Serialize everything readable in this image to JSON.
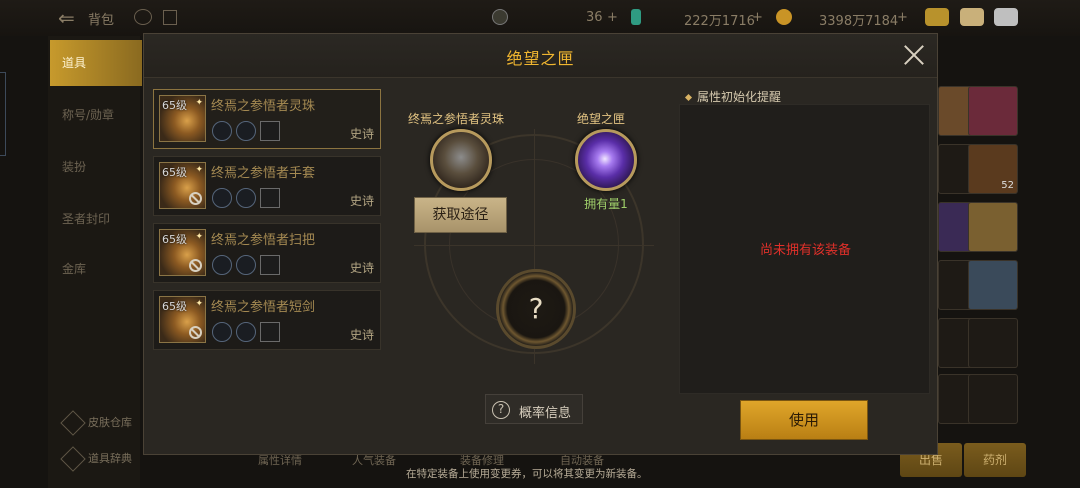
{
  "background": {
    "title": "背包",
    "currencies": [
      {
        "icon": "crescent-icon",
        "value": "36"
      },
      {
        "icon": "green-gem-icon",
        "value": "222万1716"
      },
      {
        "icon": "gold-coin-icon",
        "value": "3398万7184"
      }
    ],
    "sidebar": {
      "active": "道具",
      "items": [
        "称号/勋章",
        "装扮",
        "圣者封印",
        "金库"
      ],
      "tools": [
        "皮肤仓库",
        "道具辞典"
      ]
    },
    "bottom_buttons": [
      "属性详情",
      "人气装备",
      "装备修理",
      "自动装备"
    ],
    "action_buttons": [
      "出售",
      "药剂"
    ],
    "grid_values": [
      "52"
    ]
  },
  "modal": {
    "title": "绝望之匣",
    "items": [
      {
        "level": "65级",
        "name": "终焉之参悟者灵珠",
        "rarity": "史诗",
        "selected": true
      },
      {
        "level": "65级",
        "name": "终焉之参悟者手套",
        "rarity": "史诗",
        "selected": false
      },
      {
        "level": "65级",
        "name": "终焉之参悟者扫把",
        "rarity": "史诗",
        "selected": false
      },
      {
        "level": "65级",
        "name": "终焉之参悟者短剑",
        "rarity": "史诗",
        "selected": false
      }
    ],
    "center": {
      "left_label": "终焉之参悟者灵珠",
      "right_label": "绝望之匣",
      "owned": "拥有量1",
      "source_button": "获取途径",
      "question": "?",
      "prob_button": "概率信息",
      "hint": "在特定装备上使用变更券，可以将其变更为新装备。"
    },
    "right": {
      "title": "属性初始化提醒",
      "message": "尚未拥有该装备",
      "use_button": "使用"
    }
  },
  "colors": {
    "accent": "#f0b630",
    "error": "#e0302a",
    "owned": "#9fcf6a"
  }
}
